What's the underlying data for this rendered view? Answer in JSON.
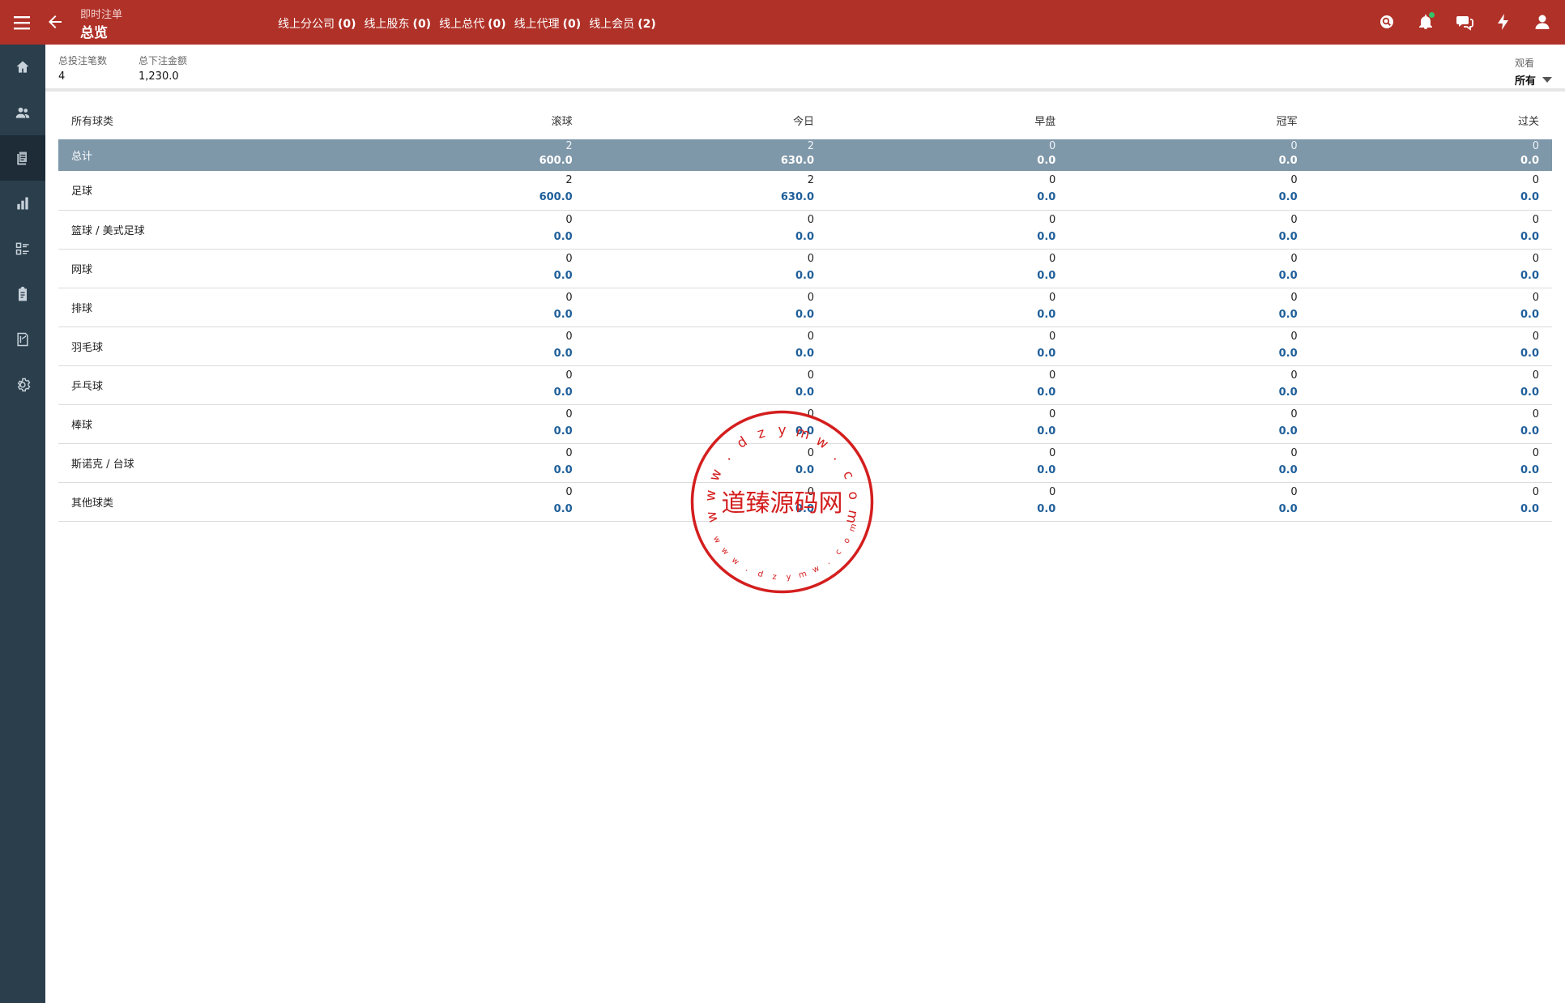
{
  "header": {
    "subtitle": "即时注单",
    "title": "总览",
    "online_links": [
      {
        "label": "线上分公司",
        "count": "(0)"
      },
      {
        "label": "线上股东",
        "count": "(0)"
      },
      {
        "label": "线上总代",
        "count": "(0)"
      },
      {
        "label": "线上代理",
        "count": "(0)"
      },
      {
        "label": "线上会员",
        "count": "(2)"
      }
    ],
    "icons": [
      "search-icon",
      "bell-icon",
      "chat-icon",
      "flash-icon",
      "user-icon"
    ],
    "accent_color": "#b03128"
  },
  "sidebar": {
    "items": [
      "home-icon",
      "users-icon",
      "documents-icon",
      "bar-chart-icon",
      "list-icon",
      "clipboard-icon",
      "report-icon",
      "settings-icon"
    ],
    "active_index": 2
  },
  "summary": {
    "total_bets_label": "总投注笔数",
    "total_bets_value": "4",
    "total_amount_label": "总下注金额",
    "total_amount_value": "1,230.0",
    "view_label": "观看",
    "view_value": "所有"
  },
  "table": {
    "headers": [
      "所有球类",
      "滚球",
      "今日",
      "早盘",
      "冠军",
      "过关"
    ],
    "total": {
      "name": "总计",
      "cells": [
        {
          "count": "2",
          "amount": "600.0"
        },
        {
          "count": "2",
          "amount": "630.0"
        },
        {
          "count": "0",
          "amount": "0.0"
        },
        {
          "count": "0",
          "amount": "0.0"
        },
        {
          "count": "0",
          "amount": "0.0"
        }
      ]
    },
    "rows": [
      {
        "name": "足球",
        "cells": [
          {
            "count": "2",
            "amount": "600.0"
          },
          {
            "count": "2",
            "amount": "630.0"
          },
          {
            "count": "0",
            "amount": "0.0"
          },
          {
            "count": "0",
            "amount": "0.0"
          },
          {
            "count": "0",
            "amount": "0.0"
          }
        ]
      },
      {
        "name": "篮球 / 美式足球",
        "cells": [
          {
            "count": "0",
            "amount": "0.0"
          },
          {
            "count": "0",
            "amount": "0.0"
          },
          {
            "count": "0",
            "amount": "0.0"
          },
          {
            "count": "0",
            "amount": "0.0"
          },
          {
            "count": "0",
            "amount": "0.0"
          }
        ]
      },
      {
        "name": "网球",
        "cells": [
          {
            "count": "0",
            "amount": "0.0"
          },
          {
            "count": "0",
            "amount": "0.0"
          },
          {
            "count": "0",
            "amount": "0.0"
          },
          {
            "count": "0",
            "amount": "0.0"
          },
          {
            "count": "0",
            "amount": "0.0"
          }
        ]
      },
      {
        "name": "排球",
        "cells": [
          {
            "count": "0",
            "amount": "0.0"
          },
          {
            "count": "0",
            "amount": "0.0"
          },
          {
            "count": "0",
            "amount": "0.0"
          },
          {
            "count": "0",
            "amount": "0.0"
          },
          {
            "count": "0",
            "amount": "0.0"
          }
        ]
      },
      {
        "name": "羽毛球",
        "cells": [
          {
            "count": "0",
            "amount": "0.0"
          },
          {
            "count": "0",
            "amount": "0.0"
          },
          {
            "count": "0",
            "amount": "0.0"
          },
          {
            "count": "0",
            "amount": "0.0"
          },
          {
            "count": "0",
            "amount": "0.0"
          }
        ]
      },
      {
        "name": "乒乓球",
        "cells": [
          {
            "count": "0",
            "amount": "0.0"
          },
          {
            "count": "0",
            "amount": "0.0"
          },
          {
            "count": "0",
            "amount": "0.0"
          },
          {
            "count": "0",
            "amount": "0.0"
          },
          {
            "count": "0",
            "amount": "0.0"
          }
        ]
      },
      {
        "name": "棒球",
        "cells": [
          {
            "count": "0",
            "amount": "0.0"
          },
          {
            "count": "0",
            "amount": "0.0"
          },
          {
            "count": "0",
            "amount": "0.0"
          },
          {
            "count": "0",
            "amount": "0.0"
          },
          {
            "count": "0",
            "amount": "0.0"
          }
        ]
      },
      {
        "name": "斯诺克 / 台球",
        "cells": [
          {
            "count": "0",
            "amount": "0.0"
          },
          {
            "count": "0",
            "amount": "0.0"
          },
          {
            "count": "0",
            "amount": "0.0"
          },
          {
            "count": "0",
            "amount": "0.0"
          },
          {
            "count": "0",
            "amount": "0.0"
          }
        ]
      },
      {
        "name": "其他球类",
        "cells": [
          {
            "count": "0",
            "amount": "0.0"
          },
          {
            "count": "0",
            "amount": "0.0"
          },
          {
            "count": "0",
            "amount": "0.0"
          },
          {
            "count": "0",
            "amount": "0.0"
          },
          {
            "count": "0",
            "amount": "0.0"
          }
        ]
      }
    ]
  },
  "watermark": {
    "center_text": "道臻源码网",
    "ring_text": "www.dzymw.com",
    "color": "#d41e1e"
  }
}
